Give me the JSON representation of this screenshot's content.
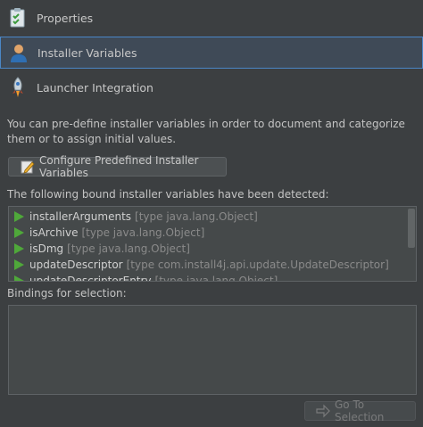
{
  "nav": {
    "items": [
      {
        "label": "Properties",
        "icon": "properties-clipboard-icon"
      },
      {
        "label": "Installer Variables",
        "icon": "user-icon"
      },
      {
        "label": "Launcher Integration",
        "icon": "rocket-icon"
      }
    ],
    "selected_index": 1
  },
  "description": "You can pre-define installer variables in order to document and categorize them or to assign initial values.",
  "configure_button": {
    "label": "Configure Predefined Installer Variables",
    "icon": "edit-icon"
  },
  "bound_label": "The following bound installer variables have been detected:",
  "variables": [
    {
      "name": "installerArguments",
      "type": "[type java.lang.Object]"
    },
    {
      "name": "isArchive",
      "type": "[type java.lang.Object]"
    },
    {
      "name": "isDmg",
      "type": "[type java.lang.Object]"
    },
    {
      "name": "updateDescriptor",
      "type": "[type com.install4j.api.update.UpdateDescriptor]"
    },
    {
      "name": "updateDescriptorEntry",
      "type": "[type java.lang.Object]"
    }
  ],
  "bindings_label": "Bindings for selection:",
  "goto_button": {
    "label": "Go To Selection",
    "icon": "arrow-right-icon"
  },
  "colors": {
    "background": "#3c3f41",
    "selection": "#3f4a57",
    "selection_border": "#4a87c7",
    "variable_icon": "#4fa83a"
  }
}
